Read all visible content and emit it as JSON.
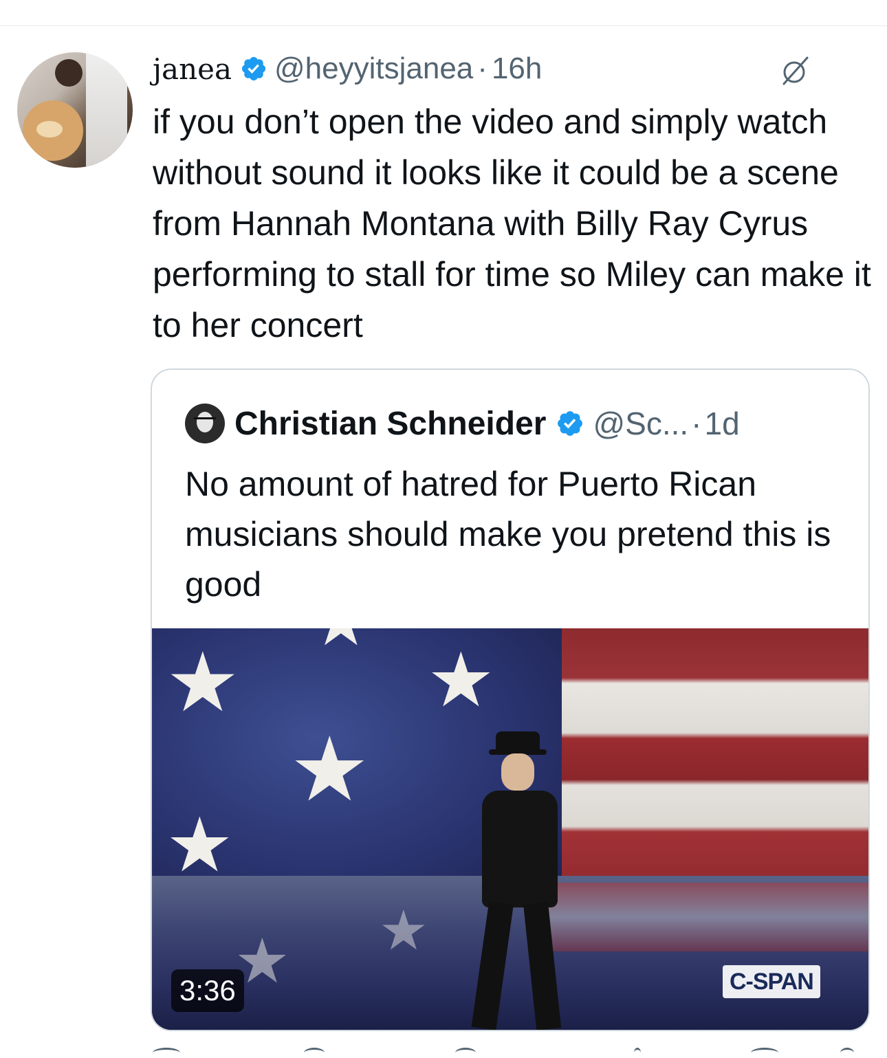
{
  "tweet": {
    "display_name": "janea",
    "handle": "@heyyitsjanea",
    "separator": "·",
    "time": "16h",
    "text": "if you don’t open the video and simply watch without sound it looks like it could be a scene from Hannah Montana with Billy Ray Cyrus performing to stall for time so Miley can make it to her concert"
  },
  "quote": {
    "display_name": "Christian Schneider",
    "handle": "@Sc...",
    "separator": "·",
    "time": "1d",
    "text": "No amount of hatred for Puerto Rican musicians should make you pretend this is good",
    "media": {
      "duration": "3:36",
      "watermark": "C-SPAN"
    }
  },
  "icons": {
    "verified": "verified-badge-icon",
    "grok": "grok-icon"
  },
  "colors": {
    "verified_blue": "#1d9bf0",
    "secondary_text": "#536471",
    "border": "#cfd9de"
  }
}
